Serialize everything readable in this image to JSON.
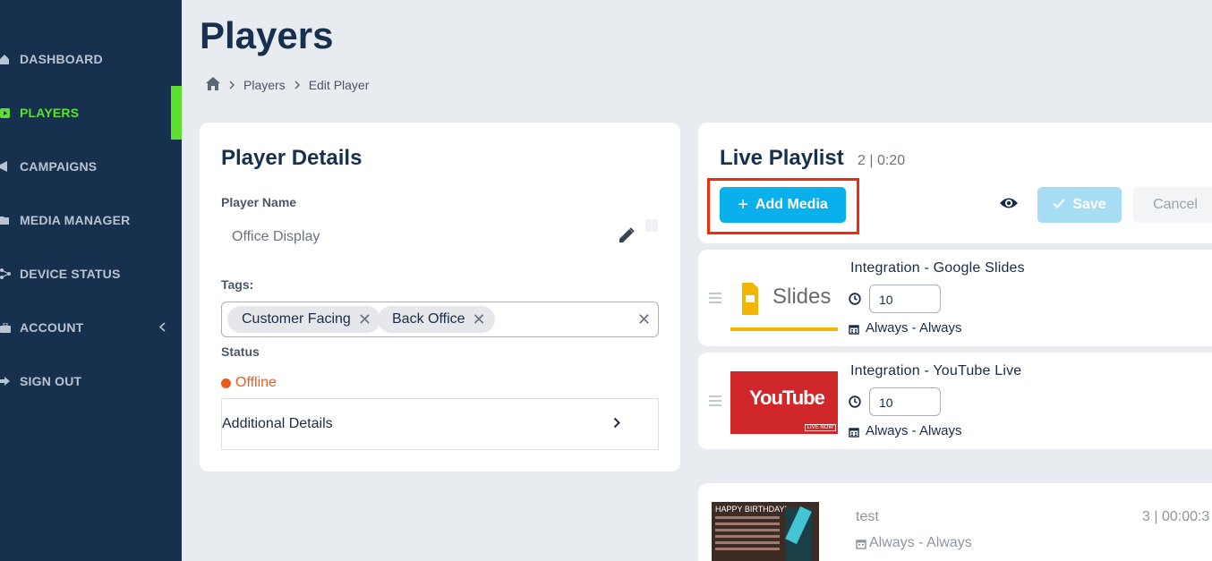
{
  "sidebar": {
    "items": [
      {
        "label": "DASHBOARD",
        "icon": "home-icon"
      },
      {
        "label": "PLAYERS",
        "icon": "play-icon",
        "active": true
      },
      {
        "label": "CAMPAIGNS",
        "icon": "megaphone-icon"
      },
      {
        "label": "MEDIA MANAGER",
        "icon": "folder-icon"
      },
      {
        "label": "DEVICE STATUS",
        "icon": "network-icon"
      },
      {
        "label": "ACCOUNT",
        "icon": "briefcase-icon"
      },
      {
        "label": "SIGN OUT",
        "icon": "sign-out-icon"
      }
    ],
    "active_color": "#5de12f"
  },
  "header": {
    "title": "Players",
    "breadcrumb": [
      "Players",
      "Edit Player"
    ]
  },
  "details": {
    "title": "Player Details",
    "name_label": "Player Name",
    "name_value": "Office Display",
    "tags_label": "Tags:",
    "tags": [
      "Customer Facing",
      "Back Office"
    ],
    "status_label": "Status",
    "status_value": "Offline",
    "status_color": "#ef5a1a",
    "additional_label": "Additional Details"
  },
  "playlist": {
    "title": "Live Playlist",
    "meta": "2 | 0:20",
    "add_media_label": "Add Media",
    "save_label": "Save",
    "cancel_label": "Cancel",
    "accent_color": "#0ab0ec",
    "items": [
      {
        "title": "Integration - Google Slides",
        "duration": "10",
        "schedule": "Always - Always",
        "thumb_text": "Slides"
      },
      {
        "title": "Integration - YouTube Live",
        "duration": "10",
        "schedule": "Always - Always",
        "thumb_text": "YouTube",
        "thumb_badge": "LIVE NOW"
      }
    ]
  },
  "other_playlist": {
    "name": "test",
    "meta": "3 | 00:00:3",
    "schedule": "Always - Always",
    "thumb_text": "HAPPY BIRTHDAY!"
  }
}
